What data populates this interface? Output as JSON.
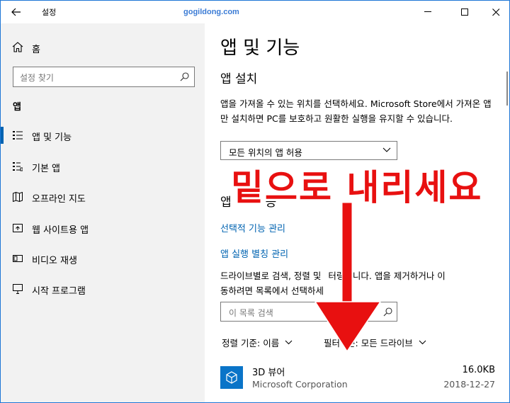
{
  "window": {
    "title": "설정",
    "watermark": "gogildong.com",
    "accent": "#0063b1"
  },
  "sidebar": {
    "home_label": "홈",
    "search_placeholder": "설정 찾기",
    "section_title": "앱",
    "items": [
      {
        "label": "앱 및 기능",
        "icon": "apps-features-icon",
        "active": true
      },
      {
        "label": "기본 앱",
        "icon": "default-apps-icon",
        "active": false
      },
      {
        "label": "오프라인 지도",
        "icon": "offline-maps-icon",
        "active": false
      },
      {
        "label": "웹 사이트용 앱",
        "icon": "apps-for-websites-icon",
        "active": false
      },
      {
        "label": "비디오 재생",
        "icon": "video-playback-icon",
        "active": false
      },
      {
        "label": "시작 프로그램",
        "icon": "startup-icon",
        "active": false
      }
    ]
  },
  "main": {
    "title": "앱 및 기능",
    "install_title": "앱 설치",
    "install_desc": "앱을 가져올 수 있는 위치를 선택하세요. Microsoft Store에서 가져온 앱만 설치하면 PC를 보호하고 원활한 실행을 유지할 수 있습니다.",
    "install_dropdown": "모든 위치의 앱 허용",
    "features_title_prefix": "앱",
    "features_title_suffix": "능",
    "link_optional": "선택적 기능 관리",
    "link_alias": "앱 실행 별칭 관리",
    "list_desc_1": "드라이브별로 검색, 정렬 및",
    "list_desc_1b": "터링합니다. 앱을 제거하거나 이",
    "list_desc_2": "동하려면 목록에서 선택하세",
    "list_search_placeholder": "이 목록 검색",
    "sort_label": "정렬 기준:",
    "sort_value": "이름",
    "filter_label_prefix": "필터",
    "filter_label_suffix": "준:",
    "filter_value": "모든 드라이브",
    "apps": [
      {
        "name": "3D 뷰어",
        "publisher": "Microsoft Corporation",
        "size": "16.0KB",
        "date": "2018-12-27"
      }
    ]
  },
  "overlay": {
    "text": "밑으로 내리세요",
    "color": "#e81010"
  }
}
